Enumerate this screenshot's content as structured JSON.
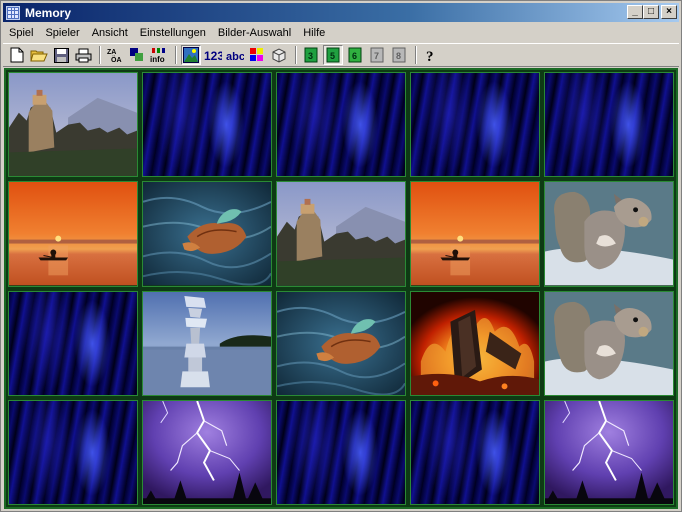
{
  "window": {
    "title": "Memory"
  },
  "title_buttons": {
    "minimize": "_",
    "maximize": "□",
    "close": "×"
  },
  "menu": [
    "Spiel",
    "Spieler",
    "Ansicht",
    "Einstellungen",
    "Bilder-Auswahl",
    "Hilfe"
  ],
  "toolbar": {
    "groups": [
      [
        "new-icon",
        "open-icon",
        "save-icon",
        "print-icon"
      ],
      [
        "sort-az-icon",
        "shapes-icon",
        "info-icon"
      ],
      [
        "picture-icon",
        "numbers-icon",
        "letters-icon",
        "colors-icon",
        "cube-icon"
      ],
      [
        "grid-3-icon",
        "grid-5-icon",
        "grid-6-icon",
        "grid-7-icon",
        "grid-8-icon"
      ],
      [
        "help-icon"
      ]
    ],
    "labels": {
      "info": "info",
      "numbers": "123",
      "letters": "abc"
    }
  },
  "board": {
    "rows": 4,
    "cols": 5,
    "cards": [
      {
        "face": "monastery"
      },
      {
        "face": "back"
      },
      {
        "face": "back"
      },
      {
        "face": "back"
      },
      {
        "face": "back"
      },
      {
        "face": "sunset"
      },
      {
        "face": "leaf"
      },
      {
        "face": "monastery"
      },
      {
        "face": "sunset"
      },
      {
        "face": "squirrel"
      },
      {
        "face": "back"
      },
      {
        "face": "stones"
      },
      {
        "face": "leaf"
      },
      {
        "face": "fire"
      },
      {
        "face": "squirrel"
      },
      {
        "face": "back"
      },
      {
        "face": "lightning"
      },
      {
        "face": "back"
      },
      {
        "face": "back"
      },
      {
        "face": "lightning"
      }
    ]
  },
  "colors": {
    "board_bg": "#0e3a14",
    "board_border": "#1a6a24",
    "title_start": "#0a246a",
    "title_end": "#a6caf0"
  }
}
